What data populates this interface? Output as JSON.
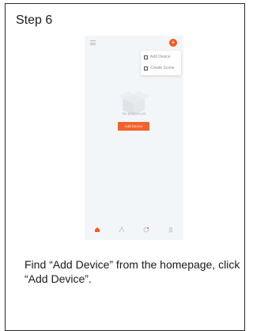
{
  "step": {
    "title": "Step 6"
  },
  "phone": {
    "popup": {
      "items": [
        {
          "label": "Add Device",
          "icon": "scan-icon"
        },
        {
          "label": "Create Scene",
          "icon": "scene-icon"
        }
      ]
    },
    "empty_state": {
      "text": "No devices yet"
    },
    "add_button": {
      "label": "Add Device"
    },
    "tabs": [
      {
        "name": "home",
        "icon": "home-icon",
        "active": true
      },
      {
        "name": "smart",
        "icon": "smart-icon"
      },
      {
        "name": "mall",
        "icon": "mall-icon"
      },
      {
        "name": "me",
        "icon": "me-icon"
      }
    ],
    "colors": {
      "accent": "#f25a1d",
      "background": "#f3f6f9"
    }
  },
  "instruction": {
    "text": "Find “Add Device” from the homepage, click “Add Device”."
  }
}
